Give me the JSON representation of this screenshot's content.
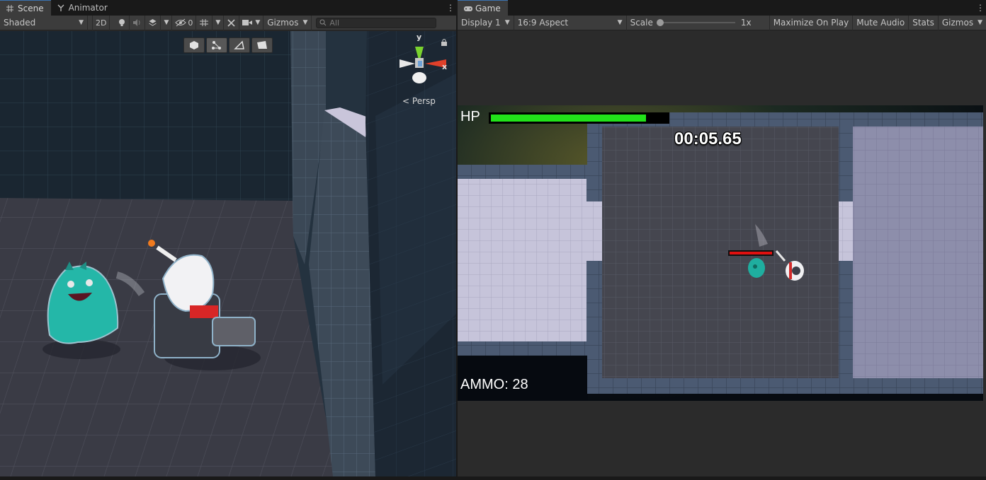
{
  "scene_panel": {
    "tabs": [
      {
        "label": "Scene",
        "icon": "grid-icon",
        "active": true
      },
      {
        "label": "Animator",
        "icon": "animator-icon",
        "active": false
      }
    ],
    "toolbar": {
      "shading_mode": "Shaded",
      "toggle_2d": "2D",
      "hidden_count": "0",
      "gizmos_label": "Gizmos",
      "search_placeholder": "All"
    },
    "view_gizmo": {
      "y_label": "y",
      "x_label": "x",
      "projection_label": "Persp"
    }
  },
  "game_panel": {
    "tab_label": "Game",
    "toolbar": {
      "display": "Display 1",
      "aspect": "16:9 Aspect",
      "scale_label": "Scale",
      "scale_value": "1x",
      "maximize_label": "Maximize On Play",
      "mute_label": "Mute Audio",
      "stats_label": "Stats",
      "gizmos_label": "Gizmos"
    },
    "hud": {
      "hp_label": "HP",
      "hp_fraction": 0.88,
      "timer": "00:05.65",
      "ammo": "AMMO: 28",
      "enemy_hp_fraction": 1.0
    }
  },
  "colors": {
    "hp_green": "#22e21a",
    "enemy_hp_red": "#e01010",
    "editor_bg": "#282828",
    "toolbar_bg": "#3c3c3c",
    "tab_active_accent": "#3a72b0"
  }
}
